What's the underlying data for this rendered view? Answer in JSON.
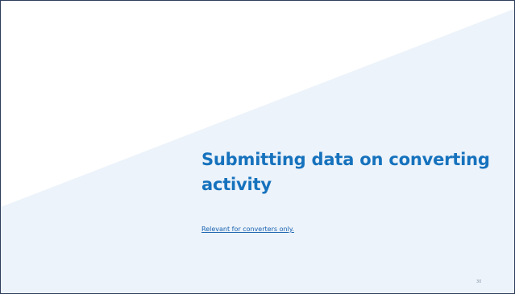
{
  "slide": {
    "title": "Submitting data on converting activity",
    "subtitle_link": "Relevant for converters only.",
    "page_number": "30"
  },
  "colors": {
    "title": "#1672bd",
    "link": "#1a62b0",
    "background_wedge": "#ecf3fa",
    "border": "#2f3d5c"
  }
}
